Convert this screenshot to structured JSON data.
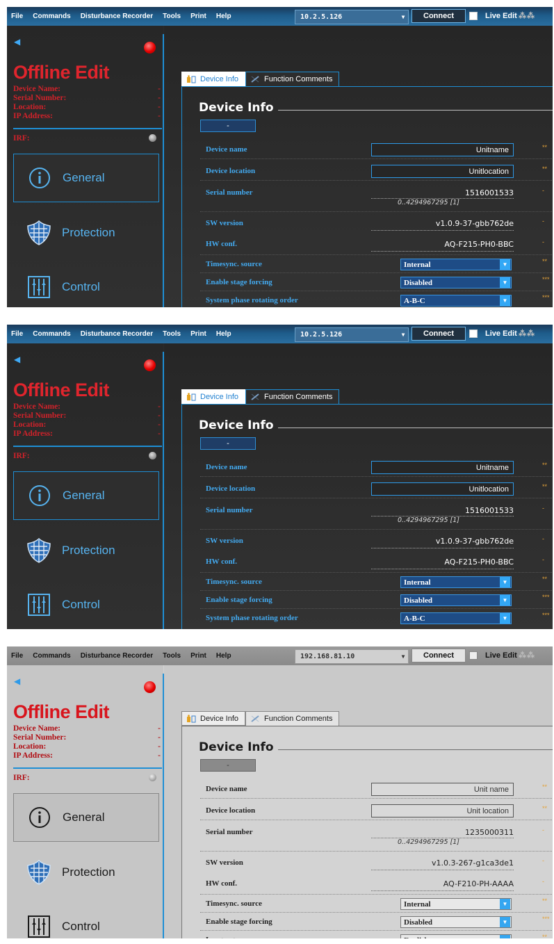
{
  "menu": {
    "items": [
      "File",
      "Commands",
      "Disturbance Recorder",
      "Tools",
      "Print",
      "Help"
    ],
    "connect_label": "Connect",
    "live_edit_label": "Live Edit",
    "live_edit_stars": "⁂⁂"
  },
  "sidebar": {
    "title": "Offline Edit",
    "info_labels": [
      "Device Name:",
      "Serial Number:",
      "Location:",
      "IP Address:"
    ],
    "info_value": "-",
    "irf_label": "IRF:",
    "nav": [
      "General",
      "Protection",
      "Control"
    ]
  },
  "tabs": [
    "Device Info",
    "Function Comments"
  ],
  "panel": {
    "title": "Device Info",
    "collapse_label": "-",
    "labels": {
      "device_name": "Device name",
      "device_location": "Device location",
      "serial_number": "Serial number",
      "sw_version": "SW version",
      "hw_conf": "HW conf.",
      "timesync": "Timesync. source",
      "stage_forcing": "Enable stage forcing",
      "phase_order": "System phase rotating order",
      "language": "Language"
    },
    "serial_range": "0..4294967295 [1]",
    "stars": {
      "two": "**",
      "three": "***",
      "one": "-"
    }
  },
  "screenshots": [
    {
      "theme": "dark",
      "ip": "10.2.5.126",
      "device_name": "Unitname",
      "device_location": "Unitlocation",
      "serial_number": "1516001533",
      "sw_version": "v1.0.9-37-gbb762de",
      "hw_conf": "AQ-F215-PH0-BBC",
      "timesync": "Internal",
      "stage_forcing": "Disabled",
      "last_row_value": "A-B-C"
    },
    {
      "theme": "dark",
      "ip": "10.2.5.126",
      "device_name": "Unitname",
      "device_location": "Unitlocation",
      "serial_number": "1516001533",
      "sw_version": "v1.0.9-37-gbb762de",
      "hw_conf": "AQ-F215-PH0-BBC",
      "timesync": "Internal",
      "stage_forcing": "Disabled",
      "last_row_value": "A-B-C"
    },
    {
      "theme": "light",
      "ip": "192.168.81.10",
      "device_name": "Unit name",
      "device_location": "Unit location",
      "serial_number": "1235000311",
      "sw_version": "v1.0.3-267-g1ca3de1",
      "hw_conf": "AQ-F210-PH-AAAA",
      "timesync": "Internal",
      "stage_forcing": "Disabled",
      "last_row_value": "English"
    }
  ],
  "colors": {
    "accent_blue": "#1e8fd5",
    "offline_red": "#e0252d",
    "star_orange": "#e3a23a"
  }
}
